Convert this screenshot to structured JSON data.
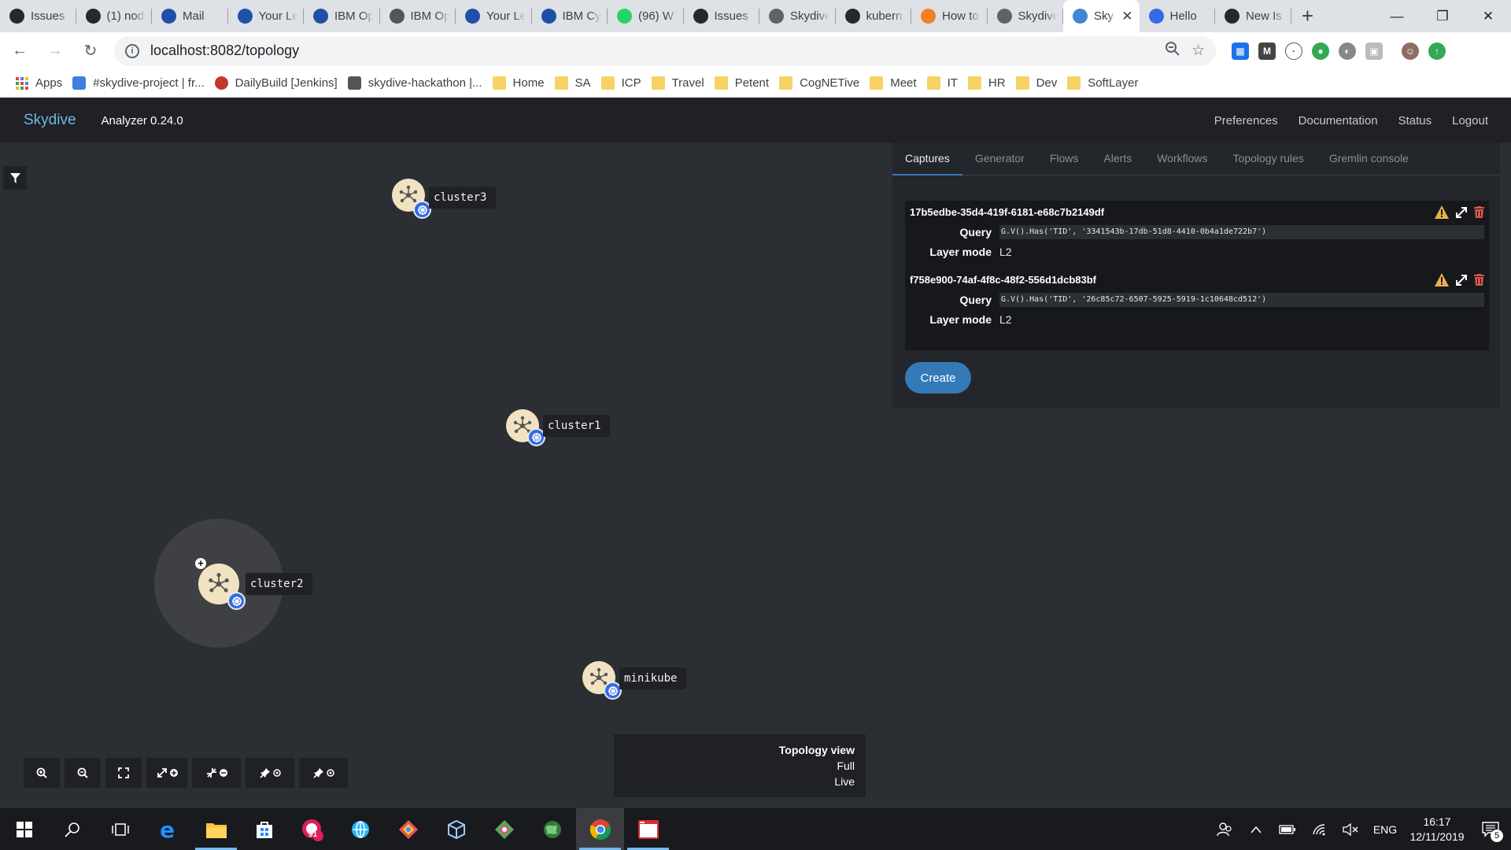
{
  "browser": {
    "tabs": [
      {
        "title": "Issues",
        "icon": "github-icon",
        "color": "#24292e"
      },
      {
        "title": "(1) node",
        "icon": "github-icon",
        "color": "#24292e"
      },
      {
        "title": "Mail",
        "icon": "vmail-icon",
        "color": "#1f4fa8"
      },
      {
        "title": "Your Le",
        "icon": "yl-icon",
        "color": "#1f4fa8"
      },
      {
        "title": "IBM Op",
        "icon": "yl-icon",
        "color": "#1f4fa8"
      },
      {
        "title": "IBM Op",
        "icon": "link-icon",
        "color": "#555555"
      },
      {
        "title": "Your Le",
        "icon": "yl-icon",
        "color": "#1f4fa8"
      },
      {
        "title": "IBM Cy",
        "icon": "teams-icon",
        "color": "#1f4fa8"
      },
      {
        "title": "(96) W",
        "icon": "whatsapp-icon",
        "color": "#25d366"
      },
      {
        "title": "Issues",
        "icon": "github-icon",
        "color": "#24292e"
      },
      {
        "title": "Skydive",
        "icon": "globe-icon",
        "color": "#5f6368"
      },
      {
        "title": "kubern",
        "icon": "github-icon",
        "color": "#24292e"
      },
      {
        "title": "How to",
        "icon": "stackoverflow-icon",
        "color": "#f48024"
      },
      {
        "title": "Skydive",
        "icon": "globe-icon",
        "color": "#5f6368"
      },
      {
        "title": "Sky",
        "icon": "skydive-icon",
        "color": "#3f87d4",
        "active": true
      },
      {
        "title": "Hello",
        "icon": "kubernetes-icon",
        "color": "#326ce5"
      },
      {
        "title": "New Is",
        "icon": "github-icon",
        "color": "#24292e"
      }
    ],
    "url": "localhost:8082/topology",
    "bookmarks": [
      {
        "label": "Apps",
        "type": "apps"
      },
      {
        "label": "#skydive-project | fr...",
        "type": "slack"
      },
      {
        "label": "DailyBuild [Jenkins]",
        "type": "jenkins"
      },
      {
        "label": "skydive-hackathon |...",
        "type": "trello"
      },
      {
        "label": "Home",
        "type": "folder"
      },
      {
        "label": "SA",
        "type": "folder"
      },
      {
        "label": "ICP",
        "type": "folder"
      },
      {
        "label": "Travel",
        "type": "folder"
      },
      {
        "label": "Petent",
        "type": "folder"
      },
      {
        "label": "CogNETive",
        "type": "folder"
      },
      {
        "label": "Meet",
        "type": "folder"
      },
      {
        "label": "IT",
        "type": "folder"
      },
      {
        "label": "HR",
        "type": "folder"
      },
      {
        "label": "Dev",
        "type": "folder"
      },
      {
        "label": "SoftLayer",
        "type": "folder"
      }
    ]
  },
  "app": {
    "brand": "Skydive",
    "version": "Analyzer 0.24.0",
    "menu": [
      "Preferences",
      "Documentation",
      "Status",
      "Logout"
    ],
    "nodes": [
      {
        "name": "cluster3"
      },
      {
        "name": "cluster1"
      },
      {
        "name": "cluster2"
      },
      {
        "name": "minikube"
      }
    ],
    "view": {
      "title": "Topology view",
      "mode": "Full",
      "state": "Live"
    },
    "panel": {
      "tabs": [
        "Captures",
        "Generator",
        "Flows",
        "Alerts",
        "Workflows",
        "Topology rules",
        "Gremlin console"
      ],
      "active_tab": "Captures",
      "query_label": "Query",
      "layer_label": "Layer mode",
      "captures": [
        {
          "id": "17b5edbe-35d4-419f-6181-e68c7b2149df",
          "query": "G.V().Has('TID', '3341543b-17db-51d8-4410-0b4a1de722b7')",
          "layer": "L2"
        },
        {
          "id": "f758e900-74af-4f8c-48f2-556d1dcb83bf",
          "query": "G.V().Has('TID', '26c85c72-6507-5925-5919-1c10648cd512')",
          "layer": "L2"
        }
      ],
      "create_label": "Create"
    }
  },
  "taskbar": {
    "time": "16:17",
    "date": "12/11/2019",
    "lang": "ENG",
    "notif_count": "5",
    "badge_count": "91"
  }
}
